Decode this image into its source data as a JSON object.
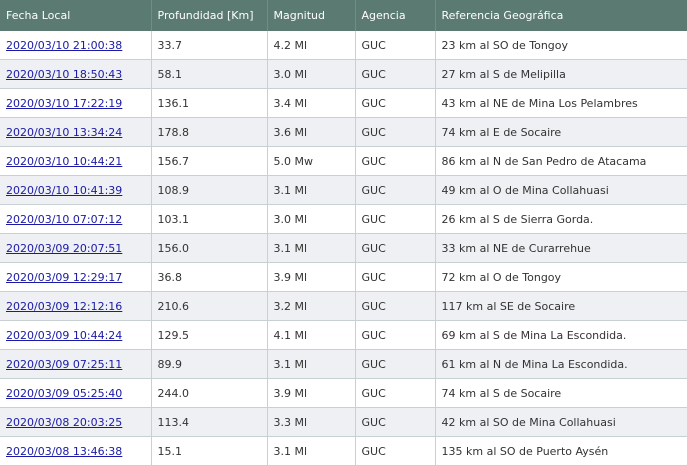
{
  "table": {
    "headers": {
      "fecha": "Fecha Local",
      "profundidad": "Profundidad [Km]",
      "magnitud": "Magnitud",
      "agencia": "Agencia",
      "referencia": "Referencia Geográfica"
    },
    "rows": [
      {
        "fecha": "2020/03/10 21:00:38",
        "profundidad": "33.7",
        "magnitud": "4.2 Ml",
        "agencia": "GUC",
        "referencia": "23 km al SO de Tongoy"
      },
      {
        "fecha": "2020/03/10 18:50:43",
        "profundidad": "58.1",
        "magnitud": "3.0 Ml",
        "agencia": "GUC",
        "referencia": "27 km al S de Melipilla"
      },
      {
        "fecha": "2020/03/10 17:22:19",
        "profundidad": "136.1",
        "magnitud": "3.4 Ml",
        "agencia": "GUC",
        "referencia": "43 km al NE de Mina Los Pelambres"
      },
      {
        "fecha": "2020/03/10 13:34:24",
        "profundidad": "178.8",
        "magnitud": "3.6 Ml",
        "agencia": "GUC",
        "referencia": "74 km al E de Socaire"
      },
      {
        "fecha": "2020/03/10 10:44:21",
        "profundidad": "156.7",
        "magnitud": "5.0 Mw",
        "agencia": "GUC",
        "referencia": "86 km al N de San Pedro de Atacama"
      },
      {
        "fecha": "2020/03/10 10:41:39",
        "profundidad": "108.9",
        "magnitud": "3.1 Ml",
        "agencia": "GUC",
        "referencia": "49 km al O de Mina Collahuasi"
      },
      {
        "fecha": "2020/03/10 07:07:12",
        "profundidad": "103.1",
        "magnitud": "3.0 Ml",
        "agencia": "GUC",
        "referencia": "26 km al S de Sierra Gorda."
      },
      {
        "fecha": "2020/03/09 20:07:51",
        "profundidad": "156.0",
        "magnitud": "3.1 Ml",
        "agencia": "GUC",
        "referencia": "33 km al NE de Curarrehue"
      },
      {
        "fecha": "2020/03/09 12:29:17",
        "profundidad": "36.8",
        "magnitud": "3.9 Ml",
        "agencia": "GUC",
        "referencia": "72 km al O de Tongoy"
      },
      {
        "fecha": "2020/03/09 12:12:16",
        "profundidad": "210.6",
        "magnitud": "3.2 Ml",
        "agencia": "GUC",
        "referencia": "117 km al SE de Socaire"
      },
      {
        "fecha": "2020/03/09 10:44:24",
        "profundidad": "129.5",
        "magnitud": "4.1 Ml",
        "agencia": "GUC",
        "referencia": "69 km al S de Mina La Escondida."
      },
      {
        "fecha": "2020/03/09 07:25:11",
        "profundidad": "89.9",
        "magnitud": "3.1 Ml",
        "agencia": "GUC",
        "referencia": "61 km al N de Mina La Escondida."
      },
      {
        "fecha": "2020/03/09 05:25:40",
        "profundidad": "244.0",
        "magnitud": "3.9 Ml",
        "agencia": "GUC",
        "referencia": "74 km al S de Socaire"
      },
      {
        "fecha": "2020/03/08 20:03:25",
        "profundidad": "113.4",
        "magnitud": "3.3 Ml",
        "agencia": "GUC",
        "referencia": "42 km al SO de Mina Collahuasi"
      },
      {
        "fecha": "2020/03/08 13:46:38",
        "profundidad": "15.1",
        "magnitud": "3.1 Ml",
        "agencia": "GUC",
        "referencia": "135 km al SO de Puerto Aysén"
      }
    ]
  },
  "colors": {
    "header_bg": "#5a7a72",
    "header_text": "#ffffff",
    "row_alt_bg": "#eef0f3",
    "link": "#1a1aa6"
  }
}
